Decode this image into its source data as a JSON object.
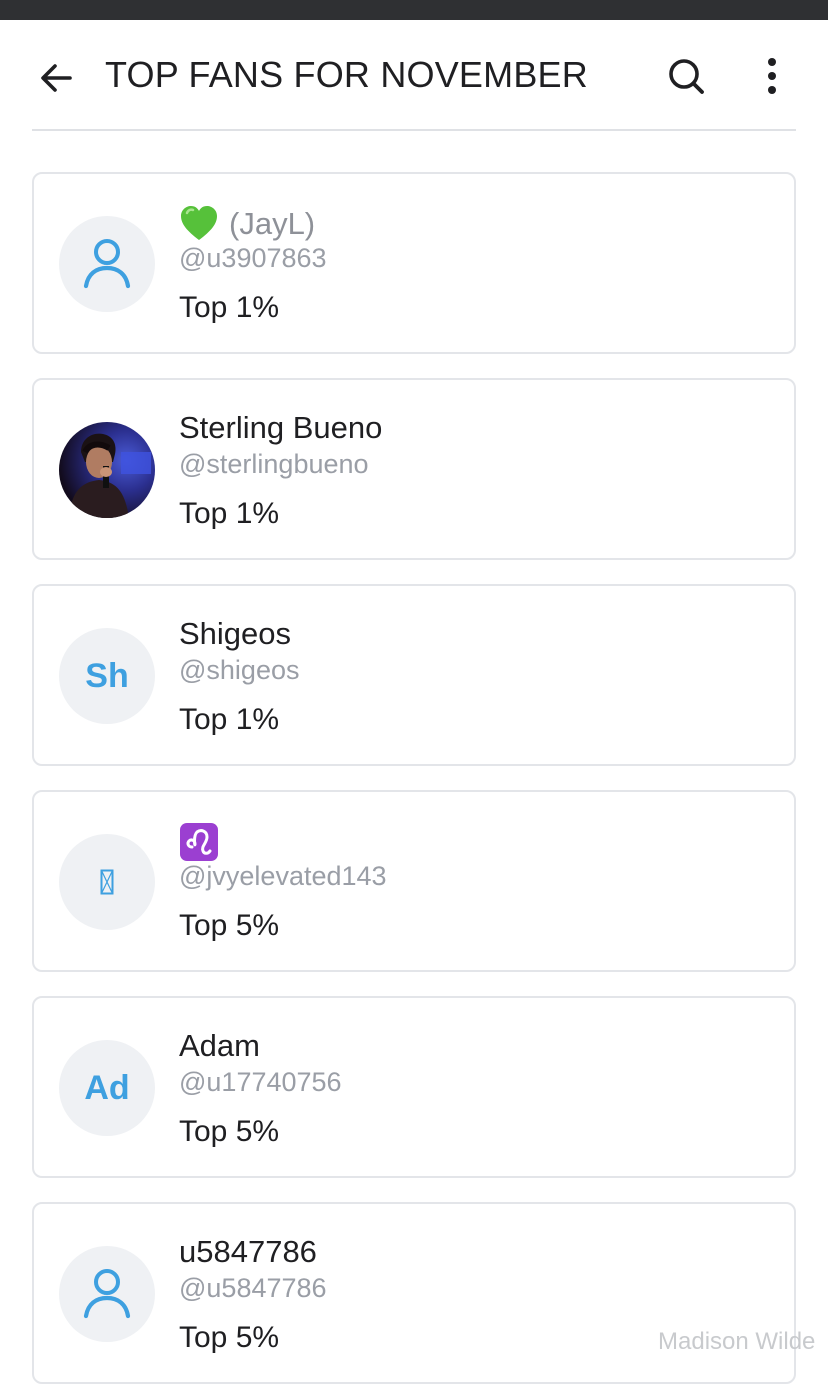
{
  "header": {
    "title": "TOP FANS FOR NOVEMBER",
    "back_icon": "arrow-left-icon",
    "search_icon": "search-icon",
    "more_icon": "more-vertical-icon"
  },
  "colors": {
    "accent": "#3ea0e0",
    "text": "#1f1f22",
    "muted": "#9a9ea6",
    "border": "#e3e5e9",
    "avatar_bg": "#eff1f4",
    "statusbar": "#2f3033"
  },
  "fans": [
    {
      "name_emoji": "green-heart-emoji",
      "name": "(JayL)",
      "handle": "@u3907863",
      "rank": "Top 1%",
      "avatar": "person-icon"
    },
    {
      "name": "Sterling Bueno",
      "handle": "@sterlingbueno",
      "rank": "Top 1%",
      "avatar": "profile-photo"
    },
    {
      "name": "Shigeos",
      "handle": "@shigeos",
      "rank": "Top 1%",
      "avatar_initials": "Sh"
    },
    {
      "name_emoji": "leo-zodiac-emoji",
      "handle": "@jvyelevated143",
      "rank": "Top 5%",
      "avatar": "missing-glyph"
    },
    {
      "name": "Adam",
      "handle": "@u17740756",
      "rank": "Top 5%",
      "avatar_initials": "Ad"
    },
    {
      "name": "u5847786",
      "handle": "@u5847786",
      "rank": "Top 5%",
      "avatar": "person-icon"
    }
  ],
  "watermark": "Madison Wilde"
}
